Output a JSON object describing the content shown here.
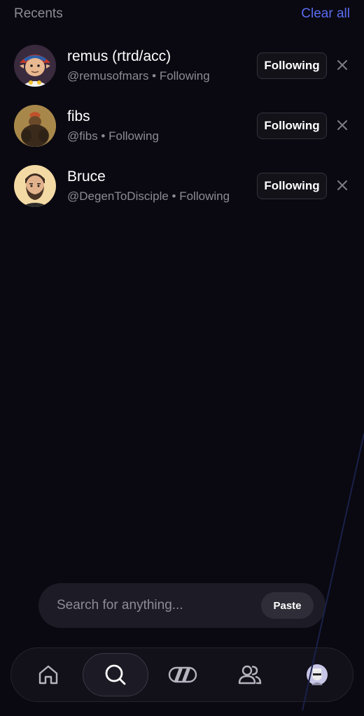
{
  "recents": {
    "title": "Recents",
    "clear_label": "Clear all"
  },
  "accounts": [
    {
      "display_name": "remus (rtrd/acc)",
      "handle_line": "@remusofmars • Following",
      "button_label": "Following",
      "avatar": "cartoon-elf-avatar"
    },
    {
      "display_name": "fibs",
      "handle_line": "@fibs • Following",
      "button_label": "Following",
      "avatar": "cartoon-figure-avatar"
    },
    {
      "display_name": "Bruce",
      "handle_line": "@DegenToDisciple • Following",
      "button_label": "Following",
      "avatar": "bearded-man-avatar"
    }
  ],
  "search": {
    "placeholder": "Search for anything...",
    "paste_label": "Paste"
  },
  "nav": {
    "items": [
      "home-icon",
      "search-icon",
      "feeds-icon",
      "people-icon",
      "profile-avatar"
    ],
    "active": "search-icon"
  },
  "colors": {
    "background": "#0a0911",
    "accent": "#5a6cf0",
    "muted_text": "#8c8b96"
  }
}
